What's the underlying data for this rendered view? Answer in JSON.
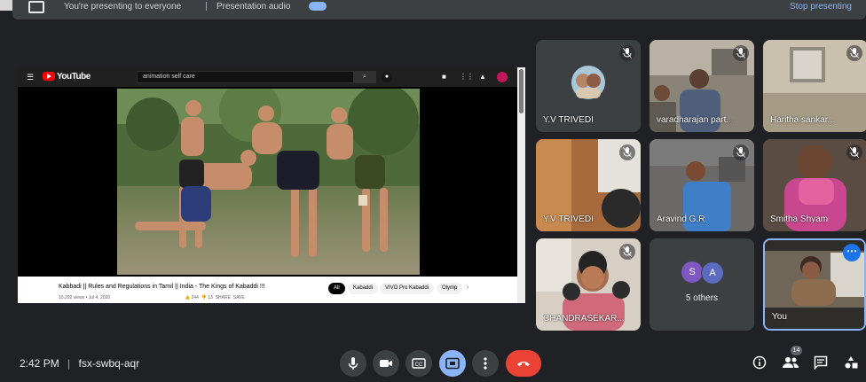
{
  "top_bar": {
    "sharing_text": "You're presenting to everyone",
    "option_text": "Presentation audio",
    "stop_label": "Stop presenting"
  },
  "youtube": {
    "brand": "YouTube",
    "search_value": "animation self care",
    "video_title": "Kabbadi || Rules and Regulations in Tamil || India - The Kings of Kabaddi !!!",
    "video_meta": "10,292 views • Jul 4, 2020",
    "actions": {
      "likes": "244",
      "dislikes": "13",
      "share": "SHARE",
      "save": "SAVE"
    },
    "chips": [
      "All",
      "Kabaddi",
      "VIVO Pro Kabaddi",
      "Olymp"
    ]
  },
  "participants": [
    {
      "name": "Y.V TRIVEDI"
    },
    {
      "name": "varadharajan part..."
    },
    {
      "name": "Haritha sankar..."
    },
    {
      "name": "Y.V TRIVEDI"
    },
    {
      "name": "Aravind G.R"
    },
    {
      "name": "Smitha Shyam"
    },
    {
      "name": "CHANDRASEKAR..."
    },
    {
      "name": "5 others",
      "initials": [
        "S",
        "A"
      ]
    },
    {
      "name": "You"
    }
  ],
  "bottom_bar": {
    "time": "2:42 PM",
    "separator": "|",
    "meeting_code": "fsx-swbq-aqr",
    "people_count": "14"
  },
  "colors": {
    "background": "#202124",
    "tile": "#3c4043",
    "accent": "#8ab4f8",
    "end_call": "#ea4335"
  },
  "icons": [
    "microphone-icon",
    "camera-icon",
    "captions-icon",
    "present-icon",
    "more-vert-icon",
    "end-call-icon",
    "info-icon",
    "people-icon",
    "chat-icon",
    "activities-icon",
    "mic-off-icon"
  ]
}
